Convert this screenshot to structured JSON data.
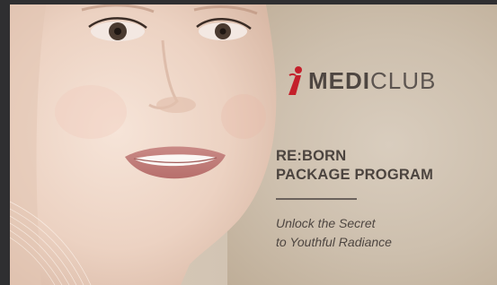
{
  "brand": {
    "logo_bold": "MEDI",
    "logo_light": "CLUB"
  },
  "headline": {
    "line1": "RE:BORN",
    "line2": "PACKAGE PROGRAM"
  },
  "tagline": {
    "line1": "Unlock the Secret",
    "line2": "to Youthful Radiance"
  },
  "colors": {
    "brand_red": "#c4202b",
    "text_dark": "#4c443f",
    "background": "#d3c5b4"
  }
}
